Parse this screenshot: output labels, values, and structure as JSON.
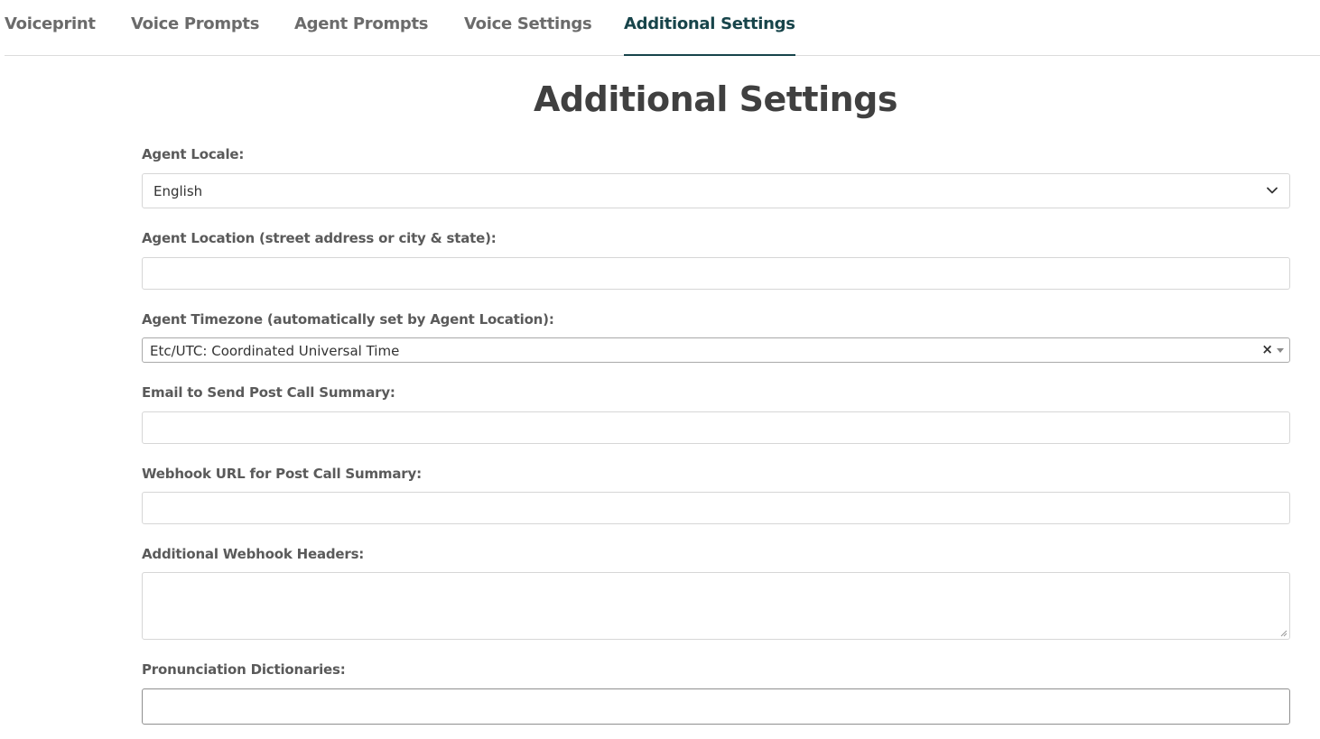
{
  "tabs": [
    {
      "label": "Voiceprint"
    },
    {
      "label": "Voice Prompts"
    },
    {
      "label": "Agent Prompts"
    },
    {
      "label": "Voice Settings"
    },
    {
      "label": "Additional Settings"
    }
  ],
  "active_tab": "Additional Settings",
  "page_title": "Additional Settings",
  "form": {
    "agent_locale": {
      "label": "Agent Locale:",
      "value": "English"
    },
    "agent_location": {
      "label": "Agent Location (street address or city & state):",
      "value": ""
    },
    "agent_timezone": {
      "label": "Agent Timezone (automatically set by Agent Location):",
      "value": "Etc/UTC: Coordinated Universal Time",
      "clear_symbol": "×"
    },
    "summary_email": {
      "label": "Email to Send Post Call Summary:",
      "value": ""
    },
    "webhook_url": {
      "label": "Webhook URL for Post Call Summary:",
      "value": ""
    },
    "webhook_headers": {
      "label": "Additional Webhook Headers:",
      "value": ""
    },
    "pronunciation_dictionaries": {
      "label": "Pronunciation Dictionaries:",
      "value": ""
    }
  },
  "colors": {
    "active_tab": "#17444a",
    "inactive_tab": "#6b6b6b",
    "title": "#404040",
    "label": "#5a5a5a",
    "border": "#d6d6d6"
  }
}
